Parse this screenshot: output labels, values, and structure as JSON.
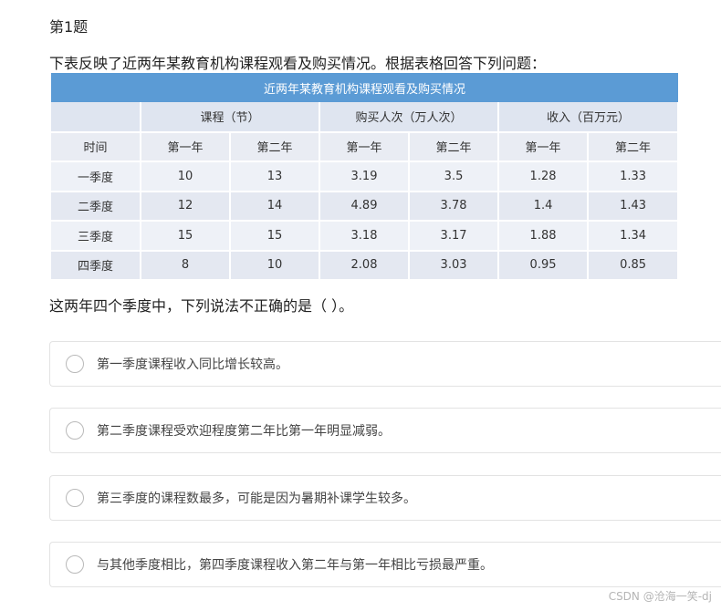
{
  "question": {
    "number_label": "第1题",
    "intro": "下表反映了近两年某教育机构课程观看及购买情况。根据表格回答下列问题：",
    "stem": "这两年四个季度中，下列说法不正确的是（ ）。"
  },
  "table": {
    "title": "近两年某教育机构课程观看及购买情况",
    "group_headers": [
      "课程（节）",
      "购买人次（万人次）",
      "收入（百万元）"
    ],
    "time_label": "时间",
    "year_labels": [
      "第一年",
      "第二年",
      "第一年",
      "第二年",
      "第一年",
      "第二年"
    ],
    "rows": [
      {
        "label": "一季度",
        "cells": [
          "10",
          "13",
          "3.19",
          "3.5",
          "1.28",
          "1.33"
        ]
      },
      {
        "label": "二季度",
        "cells": [
          "12",
          "14",
          "4.89",
          "3.78",
          "1.4",
          "1.43"
        ]
      },
      {
        "label": "三季度",
        "cells": [
          "15",
          "15",
          "3.18",
          "3.17",
          "1.88",
          "1.34"
        ]
      },
      {
        "label": "四季度",
        "cells": [
          "8",
          "10",
          "2.08",
          "3.03",
          "0.95",
          "0.85"
        ]
      }
    ]
  },
  "options": [
    {
      "text": "第一季度课程收入同比增长较高。"
    },
    {
      "text": "第二季度课程受欢迎程度第二年比第一年明显减弱。"
    },
    {
      "text": "第三季度的课程数最多，可能是因为暑期补课学生较多。"
    },
    {
      "text": "与其他季度相比，第四季度课程收入第二年与第一年相比亏损最严重。"
    }
  ],
  "watermark": "CSDN @沧海一笑-dj"
}
